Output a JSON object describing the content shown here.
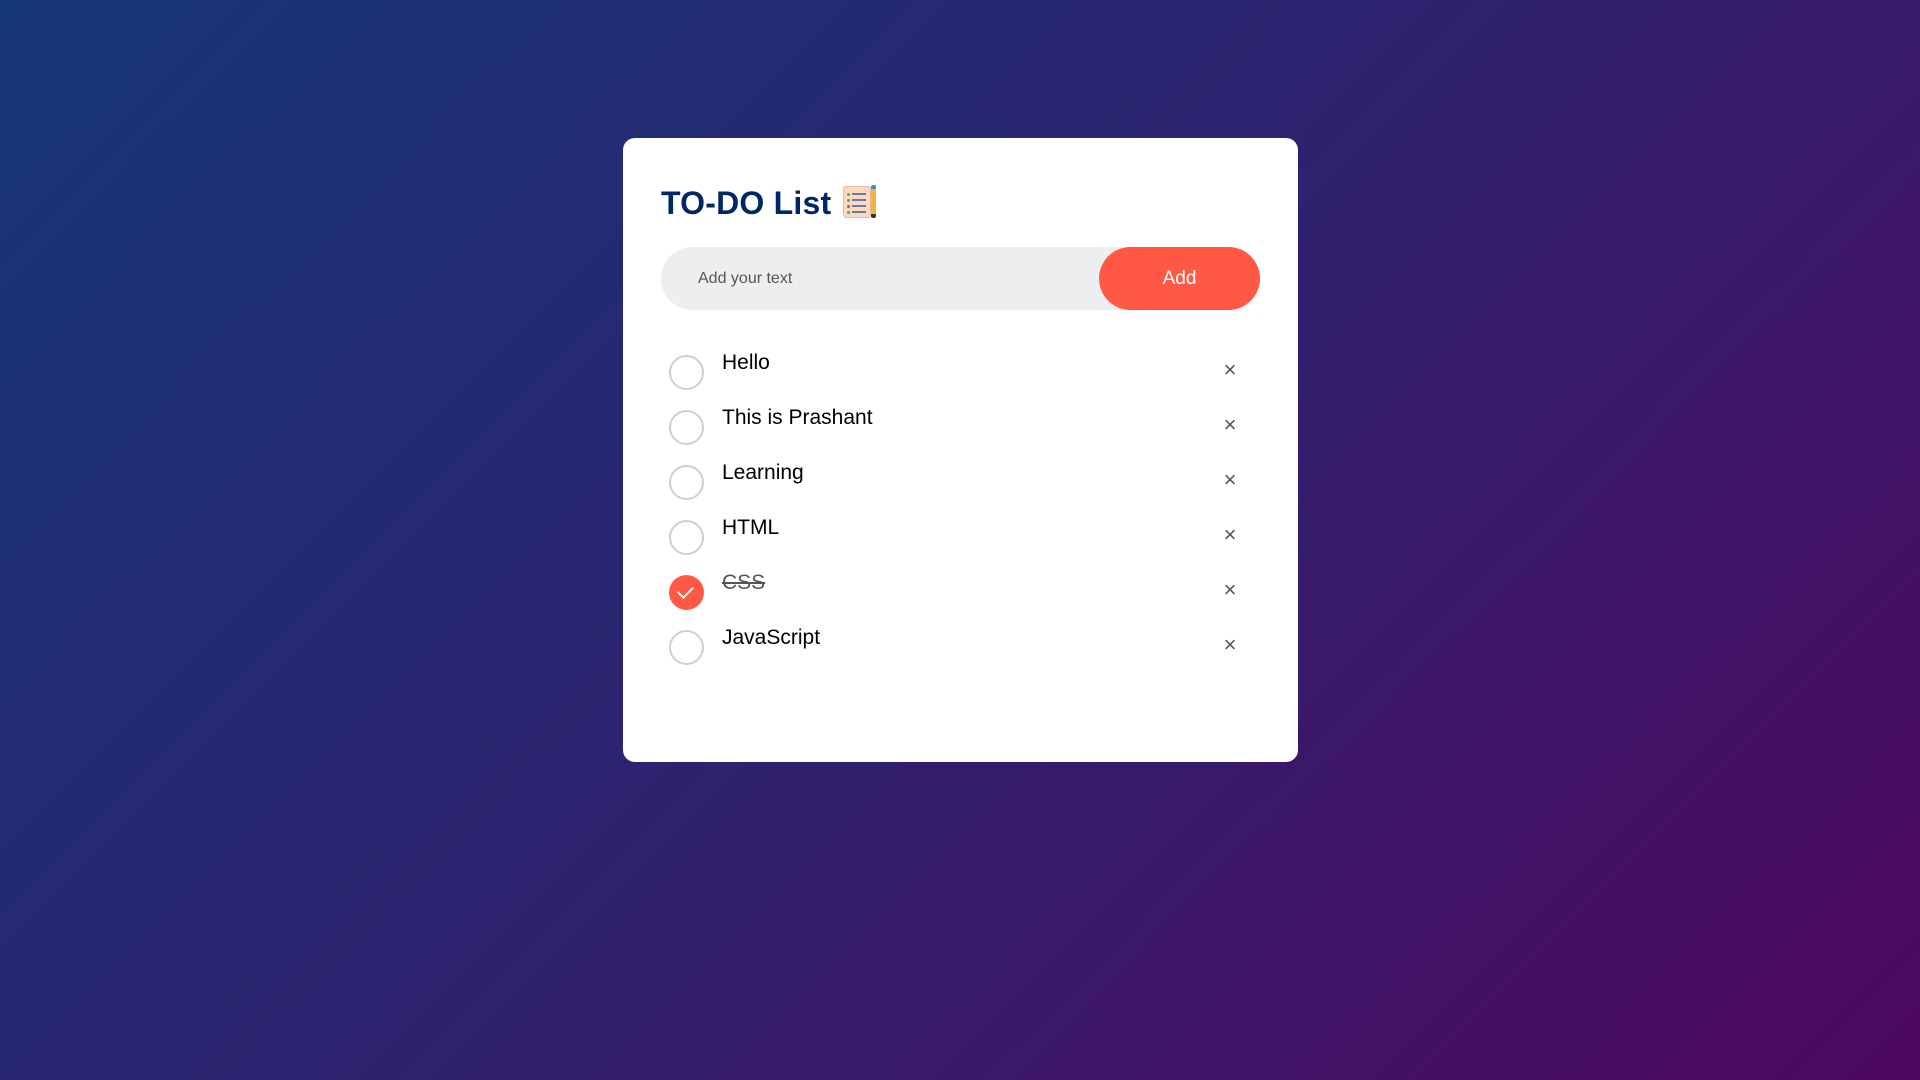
{
  "app": {
    "title": "TO-DO List",
    "title_icon": "notepad-icon"
  },
  "input": {
    "value": "",
    "placeholder": "Add your text",
    "add_label": "Add"
  },
  "colors": {
    "accent": "#ff5945",
    "title": "#002765",
    "gradient_start": "#153677",
    "gradient_end": "#4e085f"
  },
  "tasks": [
    {
      "label": "Hello",
      "checked": false,
      "remove_icon": "×"
    },
    {
      "label": "This is Prashant",
      "checked": false,
      "remove_icon": "×"
    },
    {
      "label": "Learning",
      "checked": false,
      "remove_icon": "×"
    },
    {
      "label": "HTML",
      "checked": false,
      "remove_icon": "×"
    },
    {
      "label": "CSS",
      "checked": true,
      "remove_icon": "×"
    },
    {
      "label": "JavaScript",
      "checked": false,
      "remove_icon": "×"
    }
  ]
}
